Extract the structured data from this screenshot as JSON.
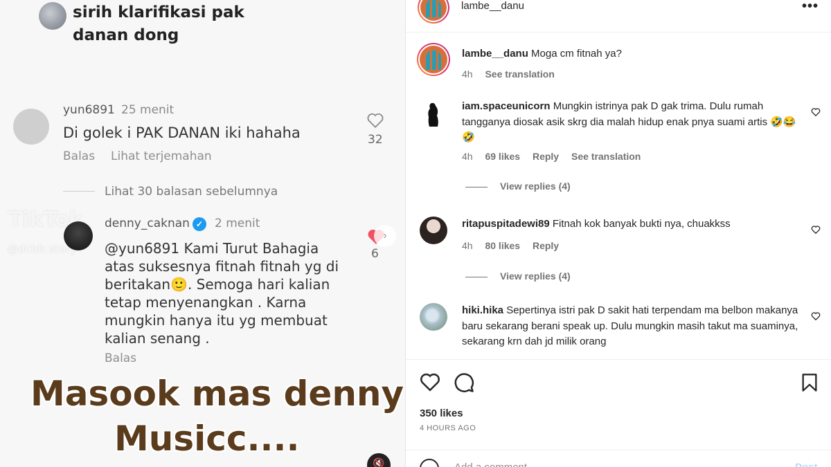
{
  "left_panel": {
    "caption": "sirih klarifikasi pak danan dong",
    "comment1": {
      "username": "yun6891",
      "time": "25 menit",
      "text": "Di golek i PAK DANAN iki hahaha",
      "reply_label": "Balas",
      "translate_label": "Lihat terjemahan",
      "like_count": "32"
    },
    "previous_replies": "Lihat 30 balasan sebelumnya",
    "comment2": {
      "username": "denny_caknan",
      "time": "2 menit",
      "text": "@yun6891 Kami Turut Bahagia\natas suksesnya fitnah fitnah yg di\nberitakan🙂. Semoga hari kalian\ntetap menyenangkan . Karna\nmungkin hanya itu yg membuat\nkalian senang .",
      "reply_label": "Balas",
      "like_count": "6"
    },
    "watermark": "TikTok",
    "watermark_handle": "@dcbb.story",
    "overlay_line1": "Masook mas denny",
    "overlay_line2": "Musicc...."
  },
  "right_panel": {
    "header": {
      "username": "lambe__danu",
      "more_icon": "more-horizontal-icon"
    },
    "comments": [
      {
        "username": "lambe__danu",
        "text": "Moga cm fitnah ya?",
        "time": "4h",
        "translate": "See translation"
      },
      {
        "username": "iam.spaceunicorn",
        "text": "Mungkin istrinya pak D gak trima. Dulu rumah tangganya diosak asik skrg dia malah hidup enak pnya suami artis 🤣😂🤣",
        "time": "4h",
        "likes": "69 likes",
        "reply": "Reply",
        "translate": "See translation",
        "view_replies": "View replies (4)"
      },
      {
        "username": "ritapuspitadewi89",
        "text": "Fitnah kok banyak bukti nya, chuakkss",
        "time": "4h",
        "likes": "80 likes",
        "reply": "Reply",
        "view_replies": "View replies (4)"
      },
      {
        "username": "hiki.hika",
        "text": "Sepertinya istri pak D sakit hati terpendam ma belbon makanya baru sekarang berani speak up. Dulu mungkin masih takut ma suaminya, sekarang krn dah jd milik orang"
      }
    ],
    "likes_count": "350 likes",
    "posted_time": "4 HOURS AGO",
    "add_comment_placeholder": "Add a comment...",
    "post_label": "Post"
  }
}
